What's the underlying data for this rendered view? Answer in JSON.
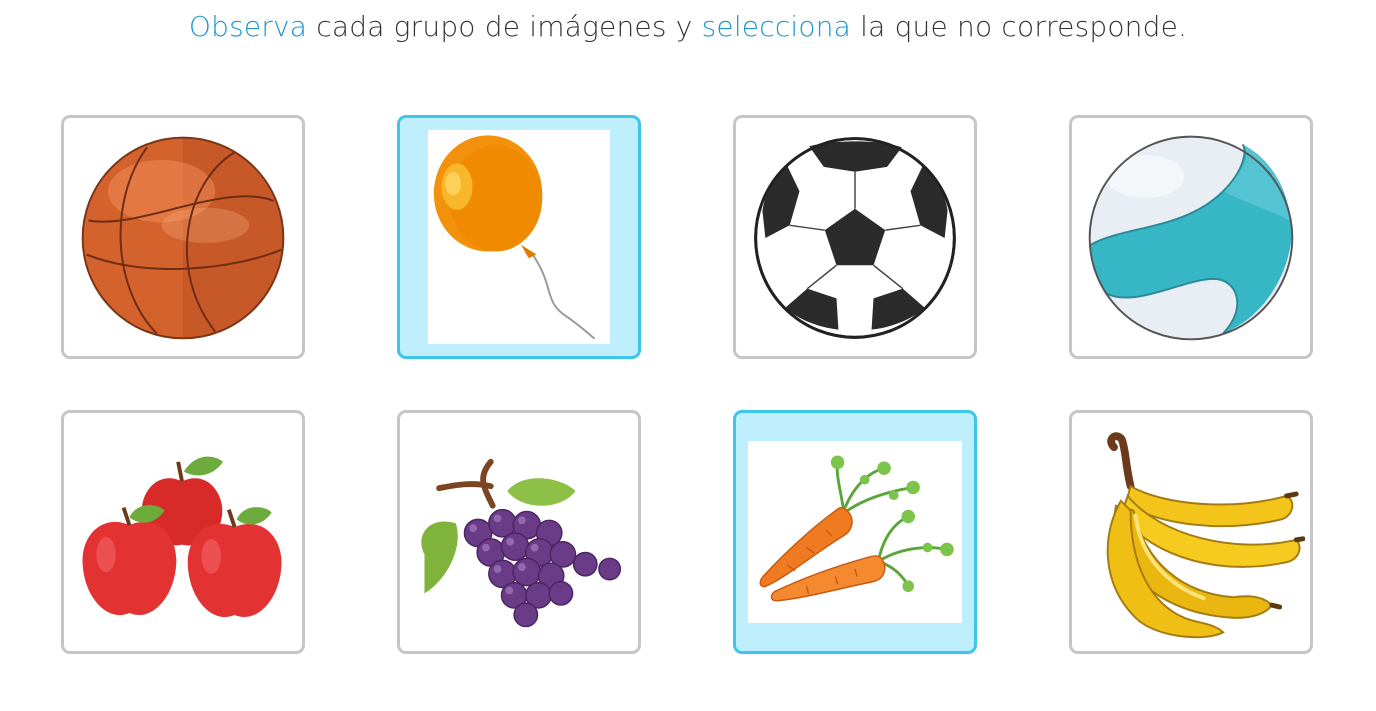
{
  "instruction": {
    "word1": "Observa",
    "text1": " cada grupo de imágenes y ",
    "word2": "selecciona",
    "text2": " la que no corresponde."
  },
  "colors": {
    "accent_text": "#1a96d0",
    "selected_border": "#3fc4ec",
    "selected_fill": "#bfeefc",
    "card_border": "#c6c6c6"
  },
  "rows": [
    {
      "cards": [
        {
          "icon": "basketball-icon",
          "selected": false
        },
        {
          "icon": "balloon-icon",
          "selected": true
        },
        {
          "icon": "soccer-ball-icon",
          "selected": false
        },
        {
          "icon": "beach-ball-icon",
          "selected": false
        }
      ]
    },
    {
      "cards": [
        {
          "icon": "apples-icon",
          "selected": false
        },
        {
          "icon": "grapes-icon",
          "selected": false
        },
        {
          "icon": "carrots-icon",
          "selected": true
        },
        {
          "icon": "bananas-icon",
          "selected": false
        }
      ]
    }
  ]
}
